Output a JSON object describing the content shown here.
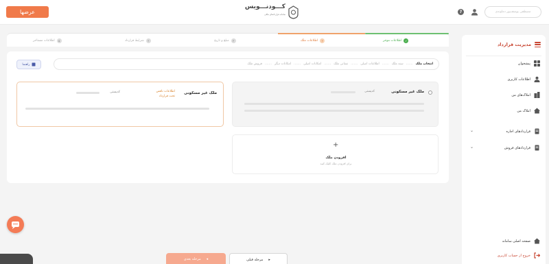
{
  "header": {
    "brand_text": "عرضها",
    "logo_title": "کـــودنـــویس",
    "logo_subtitle": "سامانه قراردادهای ملکی",
    "user_pill_text": "مصطفی یوسف‌پور دماوندی"
  },
  "sidebar": {
    "title": "مدیریت قرارداد",
    "items": [
      {
        "label": "پیشخوان",
        "icon": "dashboard-icon"
      },
      {
        "label": "اطلاعات کاربری",
        "icon": "user-icon"
      },
      {
        "label": "املاک‌های من",
        "icon": "buildings-icon"
      },
      {
        "label": "املاک من",
        "icon": "home-icon"
      },
      {
        "label": "قراردادهای اجاره",
        "icon": "document-icon"
      },
      {
        "label": "قراردادهای فروش",
        "icon": "document-icon"
      }
    ],
    "footer_items": [
      {
        "label": "صفحه اصلی سامانه",
        "icon": "home-icon"
      },
      {
        "label": "خروج از حساب کاربری",
        "icon": "logout-icon"
      }
    ]
  },
  "steps": [
    {
      "num": "✓",
      "label": "اطلاعات موجر",
      "state": "done"
    },
    {
      "num": "۲",
      "label": "اطلاعات ملک",
      "state": "active"
    },
    {
      "num": "۳",
      "label": "مبلغ و تاریخ",
      "state": "pending"
    },
    {
      "num": "۴",
      "label": "شرایط قرارداد",
      "state": "pending"
    },
    {
      "num": "۵",
      "label": "اطلاعات مستاجر",
      "state": "pending"
    }
  ],
  "guide_button": "راهنما",
  "breadcrumb": [
    "انتخاب ملک",
    "سند ملک",
    "اطلاعات اصلی",
    "نشانی ملک",
    "امکانات اصلی",
    "امکانات دیگر",
    "فروش ملک"
  ],
  "cards": {
    "selected": {
      "title": "ملک غیر مسکونی",
      "code_label": "کدپستی",
      "warning_line1": "اطلاعات ناقص",
      "warning_line2": "تحت قرارداد"
    },
    "other": {
      "title": "ملک غیر مسکونی",
      "code_label": "کدپستی"
    },
    "add": {
      "plus": "+",
      "title": "افزودن ملک",
      "subtitle": "برای افزودن ملک کلیک کنید"
    }
  },
  "footer": {
    "next_label": "مرحله بعدی",
    "prev_label": "مرحله قبلی"
  }
}
